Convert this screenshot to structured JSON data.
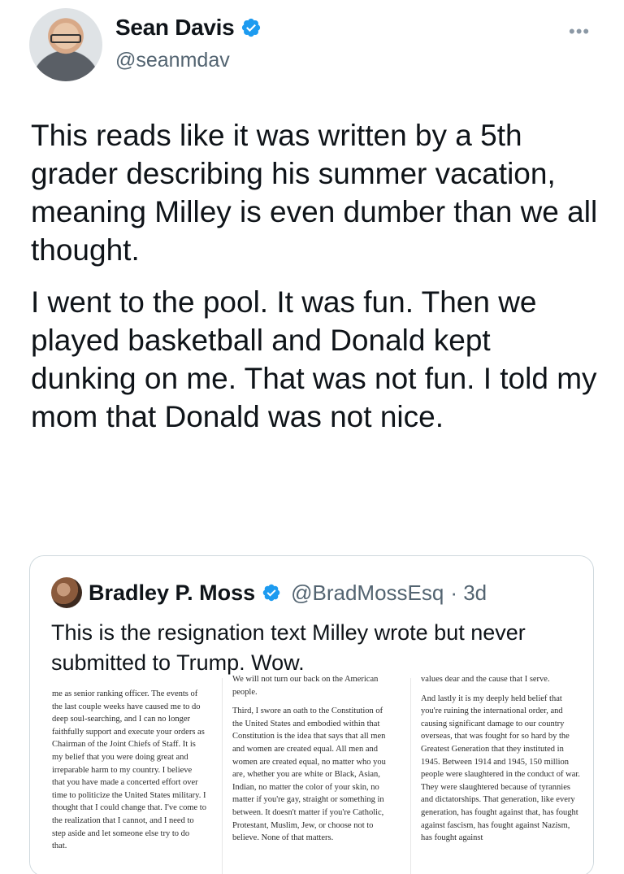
{
  "author": {
    "name": "Sean Davis",
    "handle": "@seanmdav",
    "verified": true
  },
  "more_icon": "more-horizontal-icon",
  "tweet": {
    "paragraphs": [
      "This reads like it was written by a 5th grader describing his summer vacation, meaning Milley is even dumber than we all thought.",
      "I went to the pool. It was fun. Then we played basketball and Donald kept dunking on me. That was not fun. I told my mom that Donald was not nice."
    ]
  },
  "quoted": {
    "name": "Bradley P. Moss",
    "handle": "@BradMossEsq",
    "time": "· 3d",
    "verified": true,
    "text": "This is the resignation text Milley wrote but never submitted to Trump. Wow.",
    "document": {
      "col1": [
        "me as senior ranking officer. The events of the last couple weeks have caused me to do deep soul-searching, and I can no longer faithfully support and execute your orders as Chairman of the Joint Chiefs of Staff. It is my belief that you were doing great and irreparable harm to my country. I believe that you have made a concerted effort over time to politicize the United States military. I thought that I could change that. I've come to the realization that I cannot, and I need to step aside and let someone else try to do that."
      ],
      "col2": [
        "We will not turn our back on the American people.",
        "Third, I swore an oath to the Constitution of the United States and embodied within that Constitution is the idea that says that all men and women are created equal. All men and women are created equal, no matter who you are, whether you are white or Black, Asian, Indian, no matter the color of your skin, no matter if you're gay, straight or something in between. It doesn't matter if you're Catholic, Protestant, Muslim, Jew, or choose not to believe. None of that matters."
      ],
      "col3": [
        "values dear and the cause that I serve.",
        "And lastly it is my deeply held belief that you're ruining the international order, and causing significant damage to our country overseas, that was fought for so hard by the Greatest Generation that they instituted in 1945. Between 1914 and 1945, 150 million people were slaughtered in the conduct of war. They were slaughtered because of tyrannies and dictatorships. That generation, like every generation, has fought against that, has fought against fascism, has fought against Nazism, has fought against"
      ]
    }
  },
  "colors": {
    "verified_blue": "#1d9bf0",
    "text": "#0f1419",
    "secondary": "#536471",
    "border": "#cfd9de"
  }
}
